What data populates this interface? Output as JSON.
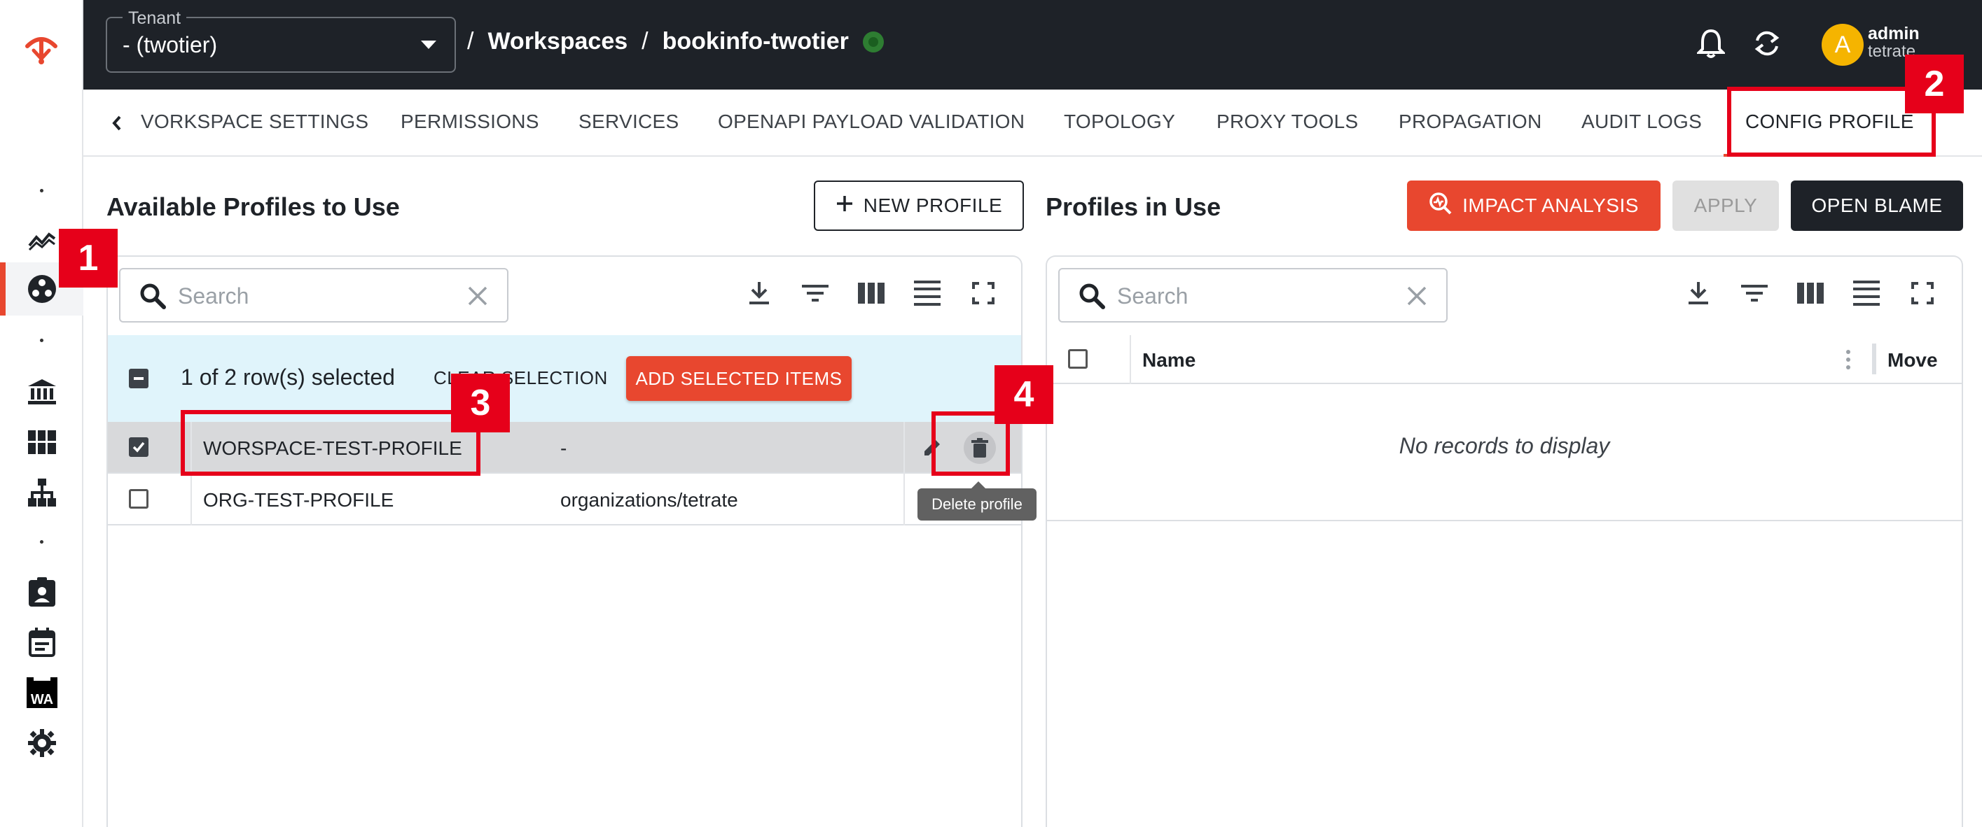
{
  "tenant": {
    "label": "Tenant",
    "value": "- (twotier)"
  },
  "breadcrumb": {
    "sep1": "/",
    "workspaces": "Workspaces",
    "sep2": "/",
    "current": "bookinfo-twotier"
  },
  "user": {
    "avatar": "A",
    "name": "admin",
    "org": "tetrate"
  },
  "tabs": [
    {
      "label": "VORKSPACE SETTINGS"
    },
    {
      "label": "PERMISSIONS"
    },
    {
      "label": "SERVICES"
    },
    {
      "label": "OPENAPI PAYLOAD VALIDATION"
    },
    {
      "label": "TOPOLOGY"
    },
    {
      "label": "PROXY TOOLS"
    },
    {
      "label": "PROPAGATION"
    },
    {
      "label": "AUDIT LOGS"
    },
    {
      "label": "CONFIG PROFILE"
    }
  ],
  "available": {
    "title": "Available Profiles to Use",
    "new_profile": "NEW PROFILE",
    "search_placeholder": "Search",
    "selection_text": "1 of 2 row(s) selected",
    "clear_selection": "CLEAR SELECTION",
    "add_selected": "ADD SELECTED ITEMS",
    "rows": [
      {
        "name": "WORSPACE-TEST-PROFILE",
        "path": "-"
      },
      {
        "name": "ORG-TEST-PROFILE",
        "path": "organizations/tetrate"
      }
    ],
    "tooltip": "Delete profile"
  },
  "in_use": {
    "title": "Profiles in Use",
    "impact_analysis": "IMPACT ANALYSIS",
    "apply": "APPLY",
    "open_blame": "OPEN BLAME",
    "search_placeholder": "Search",
    "col_name": "Name",
    "col_move": "Move",
    "empty": "No records to display"
  },
  "annotations": [
    "1",
    "2",
    "3",
    "4"
  ],
  "colors": {
    "accent": "#e8472f",
    "topbar": "#1e2228",
    "annotation": "#e6001a",
    "selection_bg": "#e0f4fb"
  },
  "icons": [
    "tetrate-logo-icon",
    "metrics-icon",
    "workspace-icon",
    "bank-icon",
    "grid-icon",
    "hierarchy-icon",
    "badge-icon",
    "calendar-icon",
    "wa-icon",
    "gear-icon",
    "bell-icon",
    "sync-icon",
    "chevron-down-icon",
    "download-icon",
    "filter-icon",
    "columns-icon",
    "density-icon",
    "fullscreen-icon",
    "search-icon",
    "close-icon",
    "edit-icon",
    "trash-icon",
    "plus-icon"
  ]
}
